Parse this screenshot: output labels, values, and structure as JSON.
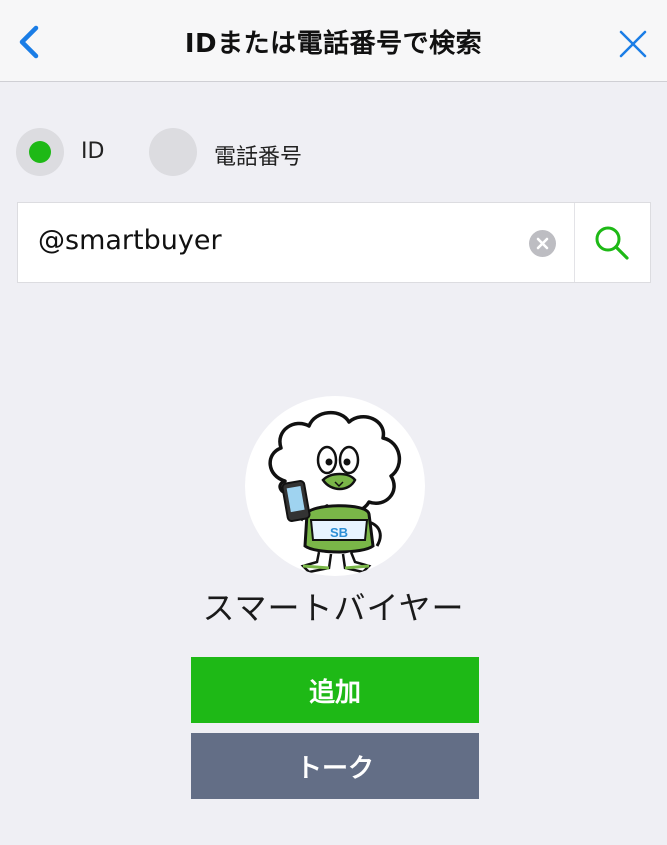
{
  "header": {
    "title": "IDまたは電話番号で検索"
  },
  "search_type": {
    "options": [
      {
        "label": "ID",
        "selected": true
      },
      {
        "label": "電話番号",
        "selected": false
      }
    ]
  },
  "search": {
    "value": "@smartbuyer"
  },
  "profile": {
    "name": "スマートバイヤー",
    "avatar_badge": "SB"
  },
  "actions": {
    "add_label": "追加",
    "talk_label": "トーク"
  },
  "colors": {
    "accent_green": "#1eb916",
    "nav_blue": "#1a7de6",
    "talk_button": "#636e86"
  }
}
